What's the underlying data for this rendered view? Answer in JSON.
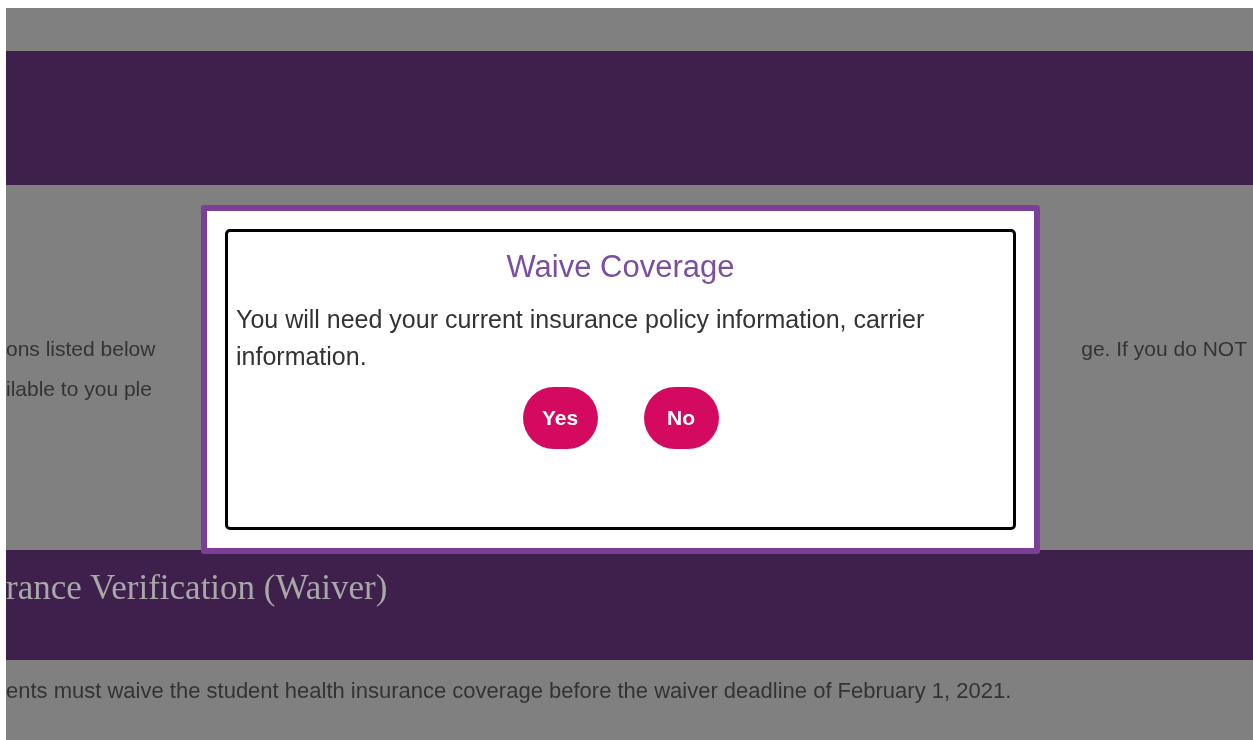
{
  "intro_lines": [
    {
      "left": "ons listed below",
      "right": "ge. If you do NOT"
    },
    {
      "left": "ilable to you ple"
    }
  ],
  "section_heading": "rance Verification (Waiver)",
  "section_text": "ents must waive the student health insurance coverage before the waiver deadline of February 1, 2021.",
  "dialog": {
    "title": "Waive Coverage",
    "message": "You will need your current insurance policy information, carrier information.",
    "buttons": [
      "Yes",
      "No"
    ]
  }
}
